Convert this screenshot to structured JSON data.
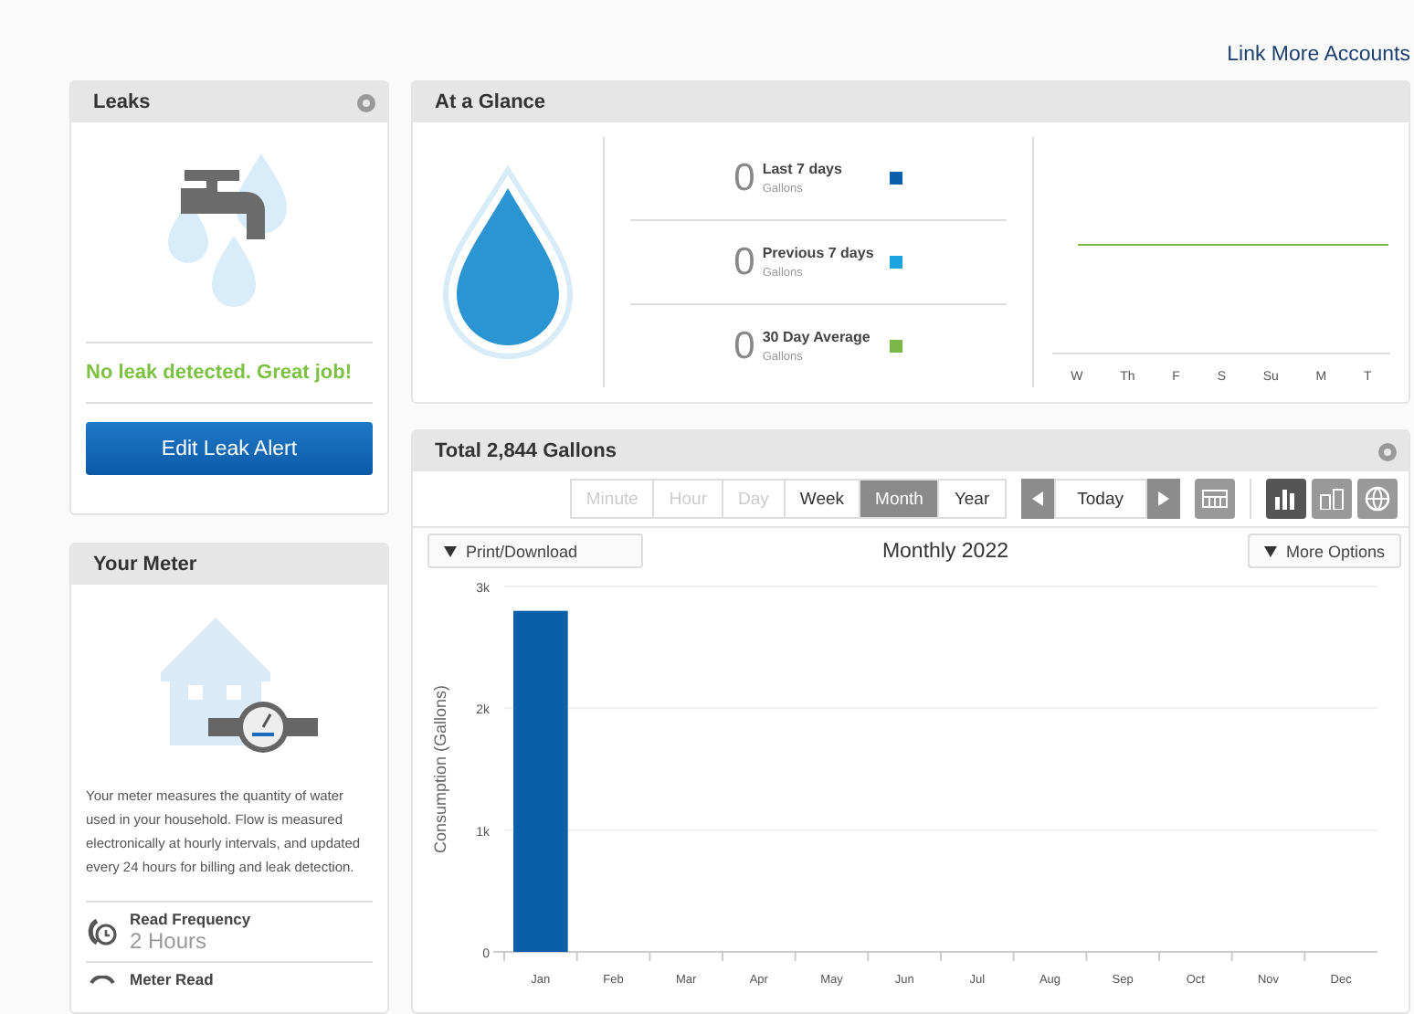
{
  "header": {
    "link": "Link More Accounts"
  },
  "leaks": {
    "title": "Leaks",
    "status": "No leak detected. Great job!",
    "button": "Edit Leak Alert"
  },
  "meter": {
    "title": "Your Meter",
    "description": "Your meter measures the quantity of water used in your household. Flow is measured electronically at hourly intervals, and updated every 24 hours for billing and leak detection.",
    "details": [
      {
        "kind": "clock",
        "label": "Read Frequency",
        "value": "2 Hours"
      },
      {
        "kind": "gauge",
        "label": "Meter Read"
      }
    ]
  },
  "glance": {
    "title": "At a Glance",
    "stats": [
      {
        "value": "0",
        "label": "Last 7 days",
        "unit": "Gallons",
        "color": "#0b5ea8"
      },
      {
        "value": "0",
        "label": "Previous 7 days",
        "unit": "Gallons",
        "color": "#1ba3e0"
      },
      {
        "value": "0",
        "label": "30 Day Average",
        "unit": "Gallons",
        "color": "#7ab648"
      }
    ],
    "day_labels": [
      "W",
      "Th",
      "F",
      "S",
      "Su",
      "M",
      "T"
    ]
  },
  "usage": {
    "title": "Total 2,844 Gallons",
    "ranges": [
      {
        "label": "Minute",
        "disabled": true,
        "selected": false
      },
      {
        "label": "Hour",
        "disabled": true,
        "selected": false
      },
      {
        "label": "Day",
        "disabled": true,
        "selected": false
      },
      {
        "label": "Week",
        "disabled": false,
        "selected": false
      },
      {
        "label": "Month",
        "disabled": false,
        "selected": true
      },
      {
        "label": "Year",
        "disabled": false,
        "selected": false
      }
    ],
    "today": "Today",
    "chart_types": [
      {
        "kind": "bar",
        "selected": true
      },
      {
        "kind": "stacked",
        "selected": false
      },
      {
        "kind": "globe",
        "selected": false
      }
    ],
    "print": "Print/Download",
    "more": "More Options",
    "chart_data": {
      "type": "bar",
      "title": "Monthly 2022",
      "ylabel": "Consumption (Gallons)",
      "categories": [
        "Jan",
        "Feb",
        "Mar",
        "Apr",
        "May",
        "Jun",
        "Jul",
        "Aug",
        "Sep",
        "Oct",
        "Nov",
        "Dec"
      ],
      "values": [
        2800,
        0,
        0,
        0,
        0,
        0,
        0,
        0,
        0,
        0,
        0,
        0
      ],
      "ylim": [
        0,
        3000
      ],
      "yticks": [
        {
          "value": 0,
          "label": "0"
        },
        {
          "value": 1000,
          "label": "1k"
        },
        {
          "value": 2000,
          "label": "2k"
        },
        {
          "value": 3000,
          "label": "3k"
        }
      ]
    }
  }
}
